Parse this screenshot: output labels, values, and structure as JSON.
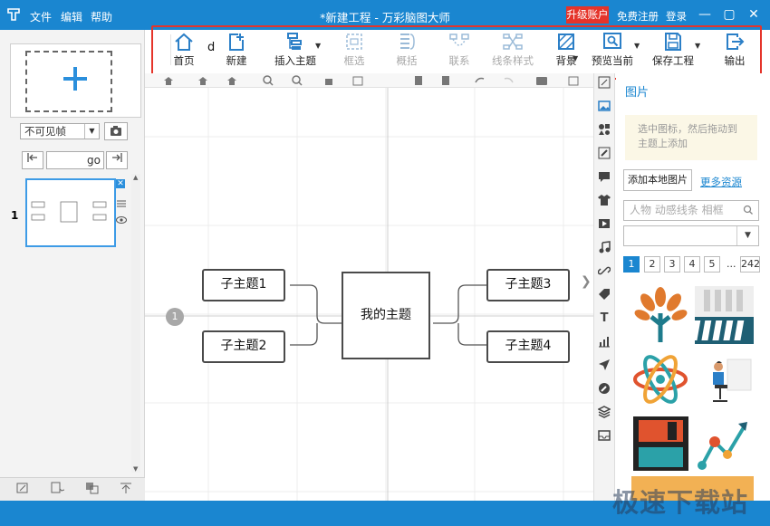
{
  "titlebar": {
    "menus": [
      "文件",
      "编辑",
      "帮助"
    ],
    "title": "*新建工程 - 万彩脑图大师",
    "upgrade": "升级账户",
    "register": "免费注册",
    "login": "登录",
    "controls": [
      "—",
      "▢",
      "✕"
    ]
  },
  "toolbar": {
    "extra_char": "d",
    "items": [
      {
        "label": "首页",
        "icon": "home-icon",
        "enabled": true
      },
      {
        "label": "新建",
        "icon": "new-doc-icon",
        "enabled": true
      },
      {
        "label": "插入主题",
        "icon": "insert-topic-icon",
        "enabled": true
      },
      {
        "label": "框选",
        "icon": "box-select-icon",
        "enabled": false
      },
      {
        "label": "概括",
        "icon": "summary-icon",
        "enabled": false
      },
      {
        "label": "联系",
        "icon": "relationship-icon",
        "enabled": false
      },
      {
        "label": "线条样式",
        "icon": "line-style-icon",
        "enabled": false
      },
      {
        "label": "背景",
        "icon": "background-icon",
        "enabled": true
      },
      {
        "label": "预览当前",
        "icon": "preview-icon",
        "enabled": true
      },
      {
        "label": "保存工程",
        "icon": "save-icon",
        "enabled": true
      },
      {
        "label": "输出",
        "icon": "export-icon",
        "enabled": true
      }
    ]
  },
  "leftpanel": {
    "frame_select": "不可见帧",
    "go_label": "go",
    "slide_number": "1"
  },
  "mindmap": {
    "central": "我的主题",
    "topics": [
      "子主题1",
      "子主题2",
      "子主题3",
      "子主题4"
    ],
    "marker": "1"
  },
  "rightpanel": {
    "title": "图片",
    "tip": "选中图标，然后拖动到主题上添加",
    "add_local": "添加本地图片",
    "more": "更多资源",
    "search_placeholder": "人物 动感线条 相框",
    "pages": [
      "1",
      "2",
      "3",
      "4",
      "5",
      "...",
      "242"
    ]
  },
  "watermark": "极速下载站"
}
